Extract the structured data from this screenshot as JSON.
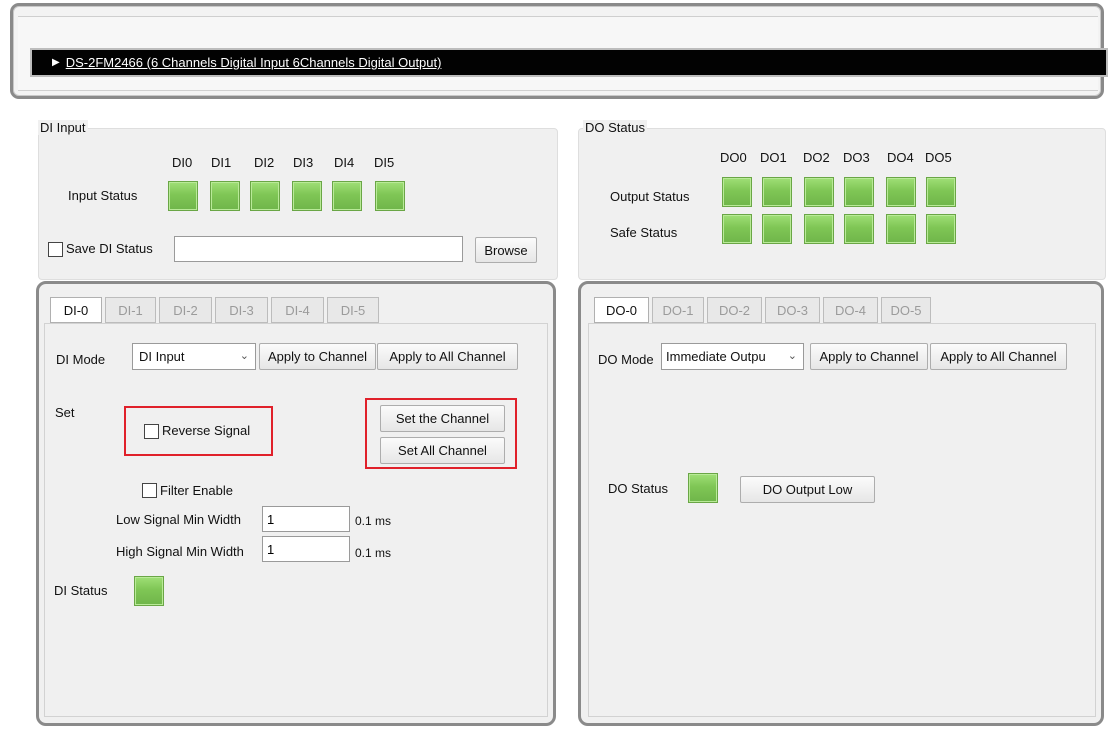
{
  "device": {
    "expander_icon": "triangle-right-icon",
    "title": "DS-2FM2466 (6 Channels Digital Input 6Channels Digital Output)"
  },
  "di_input": {
    "group_title": "DI Input",
    "channels": [
      "DI0",
      "DI1",
      "DI2",
      "DI3",
      "DI4",
      "DI5"
    ],
    "input_status_label": "Input Status",
    "save_label": "Save DI Status",
    "save_path": "",
    "browse_label": "Browse"
  },
  "do_status": {
    "group_title": "DO Status",
    "channels": [
      "DO0",
      "DO1",
      "DO2",
      "DO3",
      "DO4",
      "DO5"
    ],
    "output_status_label": "Output Status",
    "safe_status_label": "Safe Status"
  },
  "di_tabs": {
    "tabs": [
      "DI-0",
      "DI-1",
      "DI-2",
      "DI-3",
      "DI-4",
      "DI-5"
    ],
    "mode_label": "DI Mode",
    "mode_value": "DI Input",
    "apply_channel": "Apply to Channel",
    "apply_all": "Apply to All Channel",
    "set_label": "Set",
    "reverse_signal": "Reverse Signal",
    "set_channel": "Set the Channel",
    "set_all_channel": "Set All Channel",
    "filter_enable": "Filter Enable",
    "low_min_label": "Low Signal Min Width",
    "low_min_value": "1",
    "high_min_label": "High Signal Min Width",
    "high_min_value": "1",
    "unit": "0.1 ms",
    "status_label": "DI Status"
  },
  "do_tabs": {
    "tabs": [
      "DO-0",
      "DO-1",
      "DO-2",
      "DO-3",
      "DO-4",
      "DO-5"
    ],
    "mode_label": "DO Mode",
    "mode_value": "Immediate Outpu",
    "apply_channel": "Apply to Channel",
    "apply_all": "Apply to All Channel",
    "status_label": "DO Status",
    "output_low": "DO Output Low"
  },
  "colors": {
    "led_green": "#7fc655",
    "highlight_red": "#e0202a",
    "device_bar": "#020202"
  }
}
